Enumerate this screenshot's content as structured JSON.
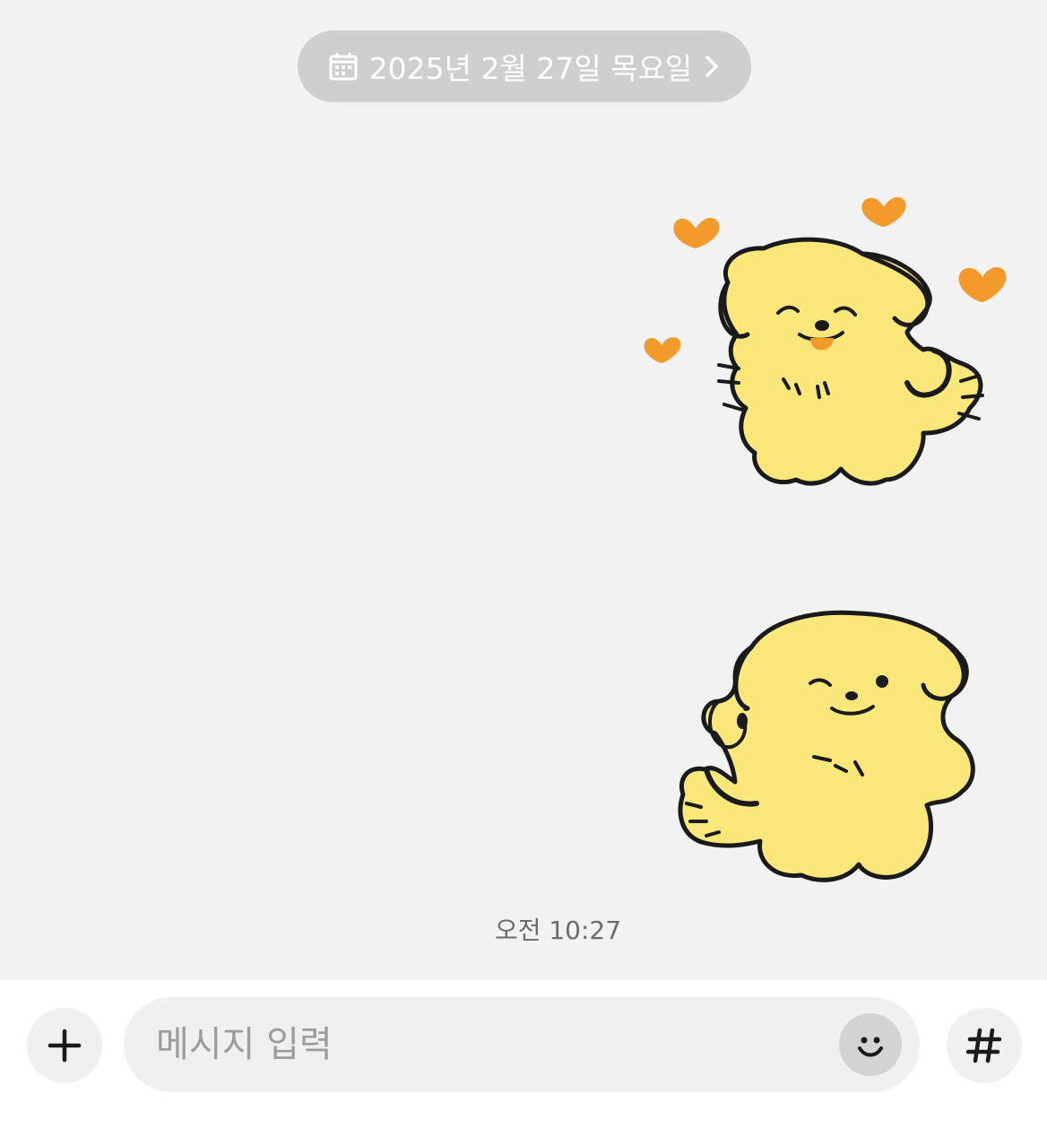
{
  "date_banner": {
    "label": "2025년 2월 27일 목요일",
    "icon": "calendar-icon",
    "chevron_icon": "chevron-right-icon"
  },
  "messages": [
    {
      "type": "sticker",
      "description_icon": "puppy-hearts-sticker"
    },
    {
      "type": "sticker",
      "description_icon": "puppy-waving-sticker"
    }
  ],
  "timestamp": "오전 10:27",
  "composer": {
    "placeholder": "메시지 입력",
    "value": "",
    "plus_icon": "plus-icon",
    "emoji_icon": "emoji-icon",
    "hash_icon": "hash-icon"
  },
  "colors": {
    "chat_background": "#f3f2f3",
    "pill_background": "#cfcfcf",
    "sticker_body": "#fbe77a",
    "heart": "#f39a2d"
  }
}
